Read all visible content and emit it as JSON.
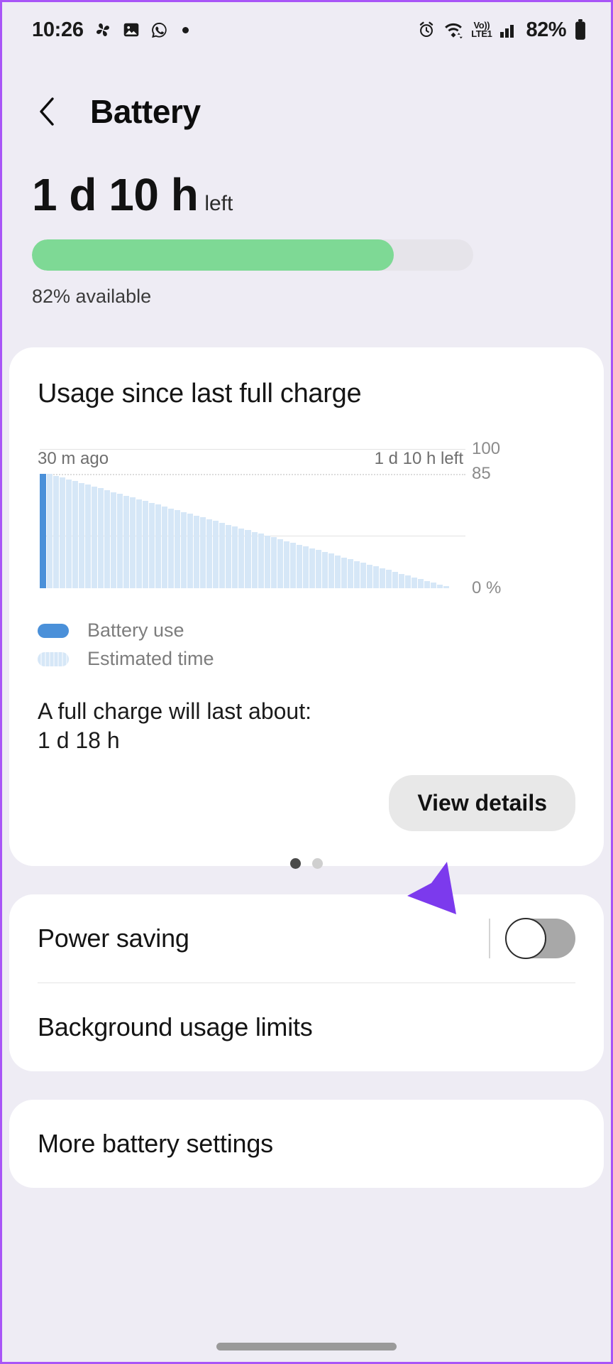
{
  "status_bar": {
    "time": "10:26",
    "battery_percent": "82%",
    "left_icons": [
      "pinwheel-icon",
      "photo-icon",
      "whatsapp-icon",
      "notification-dot-icon"
    ],
    "right_icons": [
      "alarm-icon",
      "wifi-icon",
      "volte-icon",
      "signal-bars-icon",
      "battery-icon"
    ],
    "volte_top": "Vo))",
    "volte_bottom": "LTE1"
  },
  "header": {
    "title": "Battery",
    "back_icon": "chevron-left-icon"
  },
  "summary": {
    "time_remaining": "1 d 10 h",
    "left_word": "left",
    "percent_available": "82% available",
    "fill_percent": 82,
    "bar_color": "#7ed995"
  },
  "usage_card": {
    "title": "Usage since last full charge",
    "full_charge_label": "A full charge will last about:",
    "full_charge_value": "1 d 18 h",
    "view_details_label": "View details",
    "legend": [
      {
        "label": "Battery use",
        "swatch": "solid",
        "color": "#4a90d9"
      },
      {
        "label": "Estimated time",
        "swatch": "striped",
        "color": "#d6e7f7"
      }
    ],
    "page_dots": {
      "count": 2,
      "active_index": 0
    }
  },
  "chart_data": {
    "type": "area",
    "title": "Usage since last full charge",
    "xlabel": "",
    "ylabel": "",
    "ylim": [
      0,
      100
    ],
    "grid": true,
    "legend_position": "below",
    "y_ticks": [
      "100",
      "85",
      "0 %"
    ],
    "y_tick_values": [
      100,
      85,
      0
    ],
    "x_tick_labels": [
      "30 m ago",
      "1 d 10 h left"
    ],
    "series": [
      {
        "name": "Battery use",
        "color": "#4a90d9",
        "x": [
          "30 m ago"
        ],
        "values": [
          85
        ]
      },
      {
        "name": "Estimated time",
        "color": "#d6e7f7",
        "x": [
          "30 m ago",
          "1 d 10 h left"
        ],
        "values": [
          85,
          0
        ]
      }
    ],
    "annotations": [
      "100",
      "85",
      "0 %"
    ]
  },
  "settings": {
    "power_saving": {
      "label": "Power saving",
      "toggle_state": "off"
    },
    "background_usage_limits": {
      "label": "Background usage limits"
    },
    "more_battery_settings": {
      "label": "More battery settings"
    }
  },
  "annotation": {
    "arrow_color": "#7c3aed",
    "points_to": "power-saving-toggle"
  }
}
